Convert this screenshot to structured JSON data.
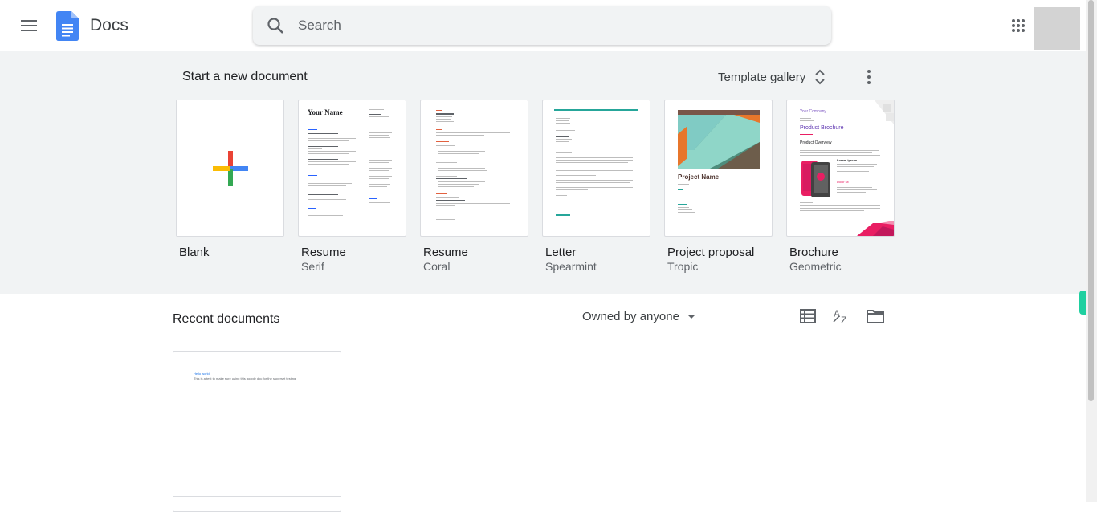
{
  "header": {
    "app_title": "Docs",
    "search_placeholder": "Search",
    "icons": [
      "menu-icon",
      "docs-logo-icon",
      "search-icon",
      "apps-grid-icon"
    ]
  },
  "templates": {
    "heading": "Start a new document",
    "gallery_label": "Template gallery",
    "items": [
      {
        "name": "Blank",
        "sub": ""
      },
      {
        "name": "Resume",
        "sub": "Serif"
      },
      {
        "name": "Resume",
        "sub": "Coral"
      },
      {
        "name": "Letter",
        "sub": "Spearmint"
      },
      {
        "name": "Project proposal",
        "sub": "Tropic"
      },
      {
        "name": "Brochure",
        "sub": "Geometric"
      }
    ],
    "thumb_text": {
      "serif_name": "Your Name",
      "proposal_title": "Project Name",
      "brochure_company": "Your Company",
      "brochure_title": "Product Brochure",
      "brochure_overview": "Product Overview",
      "brochure_lorem": "Lorem ipsum",
      "brochure_dolor": "Dolor sit"
    }
  },
  "recent": {
    "title": "Recent documents",
    "owned_filter": "Owned by anyone",
    "docs": [
      {
        "link_text": "Hello world!",
        "body_text": "This is a test to make sure using this google doc for the superset testing"
      }
    ]
  },
  "colors": {
    "accent_blue": "#4285f4",
    "plus_red": "#ea4335",
    "plus_yellow": "#fbbc04",
    "plus_green": "#34a853",
    "coral": "#e2613f",
    "spearmint": "#26a69a",
    "brochure_pink": "#e91e63"
  }
}
